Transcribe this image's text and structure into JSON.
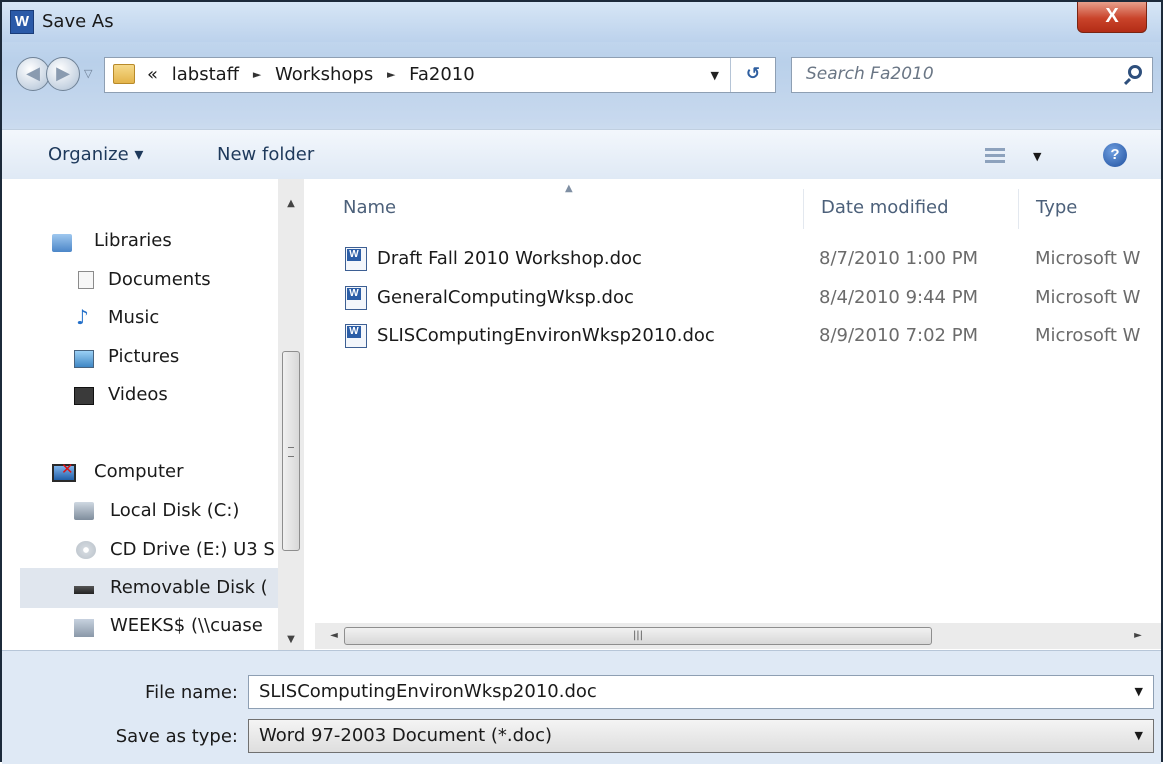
{
  "window": {
    "title": "Save As",
    "close_label": "X",
    "app_icon": "W"
  },
  "nav": {
    "back_icon": "back-arrow-icon",
    "forward_icon": "forward-arrow-icon"
  },
  "address": {
    "overflow": "«",
    "crumbs": [
      "labstaff",
      "Workshops",
      "Fa2010"
    ],
    "separator": "►"
  },
  "search": {
    "placeholder": "Search Fa2010"
  },
  "toolbar": {
    "organize_label": "Organize ▾",
    "new_folder_label": "New folder",
    "help_label": "?"
  },
  "sidebar": {
    "items": [
      {
        "label": "Libraries",
        "icon": "libraries-icon"
      },
      {
        "label": "Documents",
        "icon": "documents-icon"
      },
      {
        "label": "Music",
        "icon": "music-icon"
      },
      {
        "label": "Pictures",
        "icon": "pictures-icon"
      },
      {
        "label": "Videos",
        "icon": "videos-icon"
      },
      {
        "label": "Computer",
        "icon": "computer-icon"
      },
      {
        "label": "Local Disk (C:)",
        "icon": "local-disk-icon"
      },
      {
        "label": "CD Drive (E:) U3 S",
        "icon": "cd-drive-icon"
      },
      {
        "label": "Removable Disk (",
        "icon": "removable-disk-icon"
      },
      {
        "label": "WEEKS$ (\\\\cuase",
        "icon": "network-drive-icon"
      }
    ]
  },
  "columns": {
    "name": "Name",
    "date": "Date modified",
    "type": "Type"
  },
  "files": [
    {
      "name": "Draft Fall 2010 Workshop.doc",
      "date": "8/7/2010 1:00 PM",
      "type": "Microsoft W"
    },
    {
      "name": "GeneralComputingWksp.doc",
      "date": "8/4/2010 9:44 PM",
      "type": "Microsoft W"
    },
    {
      "name": "SLISComputingEnvironWksp2010.doc",
      "date": "8/9/2010 7:02 PM",
      "type": "Microsoft W"
    }
  ],
  "form": {
    "file_name_label": "File name:",
    "file_name_value": "SLISComputingEnvironWksp2010.doc",
    "save_type_label": "Save as type:",
    "save_type_value": "Word 97-2003 Document (*.doc)"
  },
  "colors": {
    "accent": "#1e395b",
    "close": "#c9432a",
    "selection": "#e0e6ee"
  }
}
